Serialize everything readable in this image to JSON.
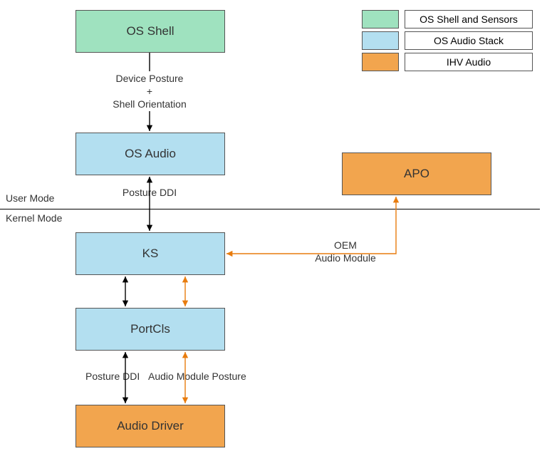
{
  "boxes": {
    "os_shell": "OS Shell",
    "os_audio": "OS Audio",
    "apo": "APO",
    "ks": "KS",
    "portcls": "PortCls",
    "audio_driver": "Audio Driver"
  },
  "annotations": {
    "device_posture": "Device Posture",
    "plus": "+",
    "shell_orientation": "Shell Orientation",
    "posture_ddi_upper": "Posture DDI",
    "oem": "OEM",
    "audio_module": "Audio Module",
    "posture_ddi_lower": "Posture DDI",
    "audio_module_posture": "Audio Module Posture",
    "user_mode": "User Mode",
    "kernel_mode": "Kernel Mode"
  },
  "legend": {
    "items": [
      {
        "label": "OS Shell and Sensors"
      },
      {
        "label": "OS Audio Stack"
      },
      {
        "label": "IHV Audio"
      }
    ]
  },
  "colors": {
    "green": "#9FE2BF",
    "blue": "#B3DFF0",
    "orange": "#F2A54E",
    "arrow_black": "#000000",
    "arrow_orange": "#E87C0E"
  }
}
